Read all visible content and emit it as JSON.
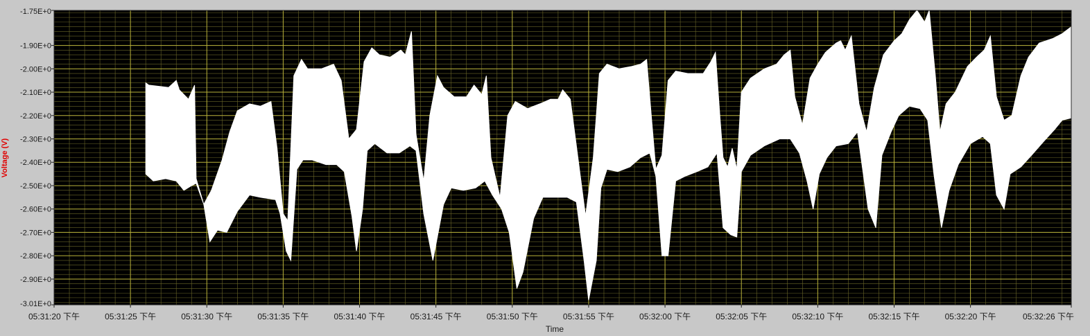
{
  "chart_data": {
    "type": "area",
    "xlabel": "Time",
    "ylabel": "Voltage (V)",
    "ylim": [
      -3.01,
      -1.75
    ],
    "xlim": [
      "05:31:20 下午",
      "05:32:26 下午"
    ],
    "grid": true,
    "colors": {
      "plot_bg": "#000000",
      "major_grid": "#b9b23a",
      "minor_grid": "#6a6628",
      "trace": "#ffffff",
      "ylabel_color": "#e00000",
      "frame_bg": "#c8c8c8"
    },
    "y_ticks": [
      {
        "value": -1.75,
        "label": "-1.75E+0"
      },
      {
        "value": -1.9,
        "label": "-1.90E+0"
      },
      {
        "value": -2.0,
        "label": "-2.00E+0"
      },
      {
        "value": -2.1,
        "label": "-2.10E+0"
      },
      {
        "value": -2.2,
        "label": "-2.20E+0"
      },
      {
        "value": -2.3,
        "label": "-2.30E+0"
      },
      {
        "value": -2.4,
        "label": "-2.40E+0"
      },
      {
        "value": -2.5,
        "label": "-2.50E+0"
      },
      {
        "value": -2.6,
        "label": "-2.60E+0"
      },
      {
        "value": -2.7,
        "label": "-2.70E+0"
      },
      {
        "value": -2.8,
        "label": "-2.80E+0"
      },
      {
        "value": -2.9,
        "label": "-2.90E+0"
      },
      {
        "value": -3.01,
        "label": "-3.01E+0"
      }
    ],
    "x_ticks": [
      {
        "t": 0,
        "label": "05:31:20 下午"
      },
      {
        "t": 5,
        "label": "05:31:25 下午"
      },
      {
        "t": 10,
        "label": "05:31:30 下午"
      },
      {
        "t": 15,
        "label": "05:31:35 下午"
      },
      {
        "t": 20,
        "label": "05:31:40 下午"
      },
      {
        "t": 25,
        "label": "05:31:45 下午"
      },
      {
        "t": 30,
        "label": "05:31:50 下午"
      },
      {
        "t": 35,
        "label": "05:31:55 下午"
      },
      {
        "t": 40,
        "label": "05:32:00 下午"
      },
      {
        "t": 45,
        "label": "05:32:05 下午"
      },
      {
        "t": 50,
        "label": "05:32:10 下午"
      },
      {
        "t": 55,
        "label": "05:32:15 下午"
      },
      {
        "t": 60,
        "label": "05:32:20 下午"
      },
      {
        "t": 66.6,
        "label": "05:32:26 下午"
      }
    ],
    "series": [
      {
        "x_unit": "seconds after 05:31:20 下午",
        "upper": [
          [
            6.0,
            -2.06
          ],
          [
            6.2,
            -2.07
          ],
          [
            7.5,
            -2.08
          ],
          [
            8.0,
            -2.05
          ],
          [
            8.2,
            -2.09
          ],
          [
            8.8,
            -2.13
          ],
          [
            9.2,
            -2.07
          ],
          [
            9.3,
            -2.47
          ],
          [
            9.8,
            -2.58
          ],
          [
            10.3,
            -2.52
          ],
          [
            11.0,
            -2.39
          ],
          [
            11.5,
            -2.27
          ],
          [
            12.0,
            -2.18
          ],
          [
            12.8,
            -2.15
          ],
          [
            13.5,
            -2.16
          ],
          [
            14.2,
            -2.14
          ],
          [
            14.6,
            -2.34
          ],
          [
            15.0,
            -2.62
          ],
          [
            15.3,
            -2.65
          ],
          [
            15.7,
            -2.03
          ],
          [
            16.2,
            -1.96
          ],
          [
            16.6,
            -2.0
          ],
          [
            17.5,
            -2.0
          ],
          [
            18.3,
            -1.98
          ],
          [
            18.8,
            -2.05
          ],
          [
            19.3,
            -2.3
          ],
          [
            19.8,
            -2.26
          ],
          [
            20.3,
            -1.97
          ],
          [
            20.8,
            -1.91
          ],
          [
            21.3,
            -1.94
          ],
          [
            22.0,
            -1.95
          ],
          [
            22.7,
            -1.92
          ],
          [
            23.0,
            -1.94
          ],
          [
            23.4,
            -1.84
          ],
          [
            23.7,
            -2.28
          ],
          [
            24.2,
            -2.48
          ],
          [
            24.6,
            -2.2
          ],
          [
            25.1,
            -2.03
          ],
          [
            25.5,
            -2.08
          ],
          [
            26.2,
            -2.12
          ],
          [
            27.0,
            -2.12
          ],
          [
            27.5,
            -2.07
          ],
          [
            28.0,
            -2.11
          ],
          [
            28.3,
            -2.03
          ],
          [
            28.6,
            -2.38
          ],
          [
            29.2,
            -2.55
          ],
          [
            29.7,
            -2.2
          ],
          [
            30.2,
            -2.14
          ],
          [
            31.0,
            -2.17
          ],
          [
            31.8,
            -2.15
          ],
          [
            32.5,
            -2.13
          ],
          [
            33.0,
            -2.13
          ],
          [
            33.3,
            -2.09
          ],
          [
            33.8,
            -2.13
          ],
          [
            34.4,
            -2.43
          ],
          [
            34.8,
            -2.63
          ],
          [
            35.3,
            -2.38
          ],
          [
            35.7,
            -2.02
          ],
          [
            36.2,
            -1.98
          ],
          [
            37.0,
            -2.0
          ],
          [
            37.8,
            -1.99
          ],
          [
            38.4,
            -1.98
          ],
          [
            38.8,
            -1.96
          ],
          [
            39.1,
            -2.2
          ],
          [
            39.4,
            -2.43
          ],
          [
            39.8,
            -2.37
          ],
          [
            40.2,
            -2.05
          ],
          [
            40.7,
            -2.01
          ],
          [
            41.5,
            -2.02
          ],
          [
            42.5,
            -2.02
          ],
          [
            43.0,
            -1.97
          ],
          [
            43.3,
            -1.93
          ],
          [
            43.6,
            -2.21
          ],
          [
            43.8,
            -2.38
          ],
          [
            44.1,
            -2.42
          ],
          [
            44.4,
            -2.34
          ],
          [
            44.7,
            -2.43
          ],
          [
            45.0,
            -2.1
          ],
          [
            45.6,
            -2.04
          ],
          [
            46.5,
            -2.0
          ],
          [
            47.3,
            -1.98
          ],
          [
            47.8,
            -1.94
          ],
          [
            48.2,
            -1.92
          ],
          [
            48.5,
            -2.12
          ],
          [
            49.0,
            -2.24
          ],
          [
            49.5,
            -2.04
          ],
          [
            50.0,
            -1.98
          ],
          [
            50.5,
            -1.93
          ],
          [
            51.2,
            -1.89
          ],
          [
            51.5,
            -1.88
          ],
          [
            51.8,
            -1.92
          ],
          [
            52.2,
            -1.86
          ],
          [
            52.7,
            -2.15
          ],
          [
            53.2,
            -2.27
          ],
          [
            53.7,
            -2.08
          ],
          [
            54.3,
            -1.94
          ],
          [
            55.0,
            -1.88
          ],
          [
            55.5,
            -1.85
          ],
          [
            56.0,
            -1.79
          ],
          [
            56.5,
            -1.75
          ],
          [
            57.0,
            -1.8
          ],
          [
            57.3,
            -1.75
          ],
          [
            57.7,
            -2.03
          ],
          [
            58.0,
            -2.27
          ],
          [
            58.4,
            -2.15
          ],
          [
            59.0,
            -2.1
          ],
          [
            59.8,
            -1.99
          ],
          [
            60.4,
            -1.95
          ],
          [
            60.9,
            -1.92
          ],
          [
            61.3,
            -1.86
          ],
          [
            61.7,
            -2.12
          ],
          [
            62.2,
            -2.22
          ],
          [
            62.7,
            -2.2
          ],
          [
            63.3,
            -2.03
          ],
          [
            63.8,
            -1.95
          ],
          [
            64.5,
            -1.89
          ],
          [
            65.4,
            -1.87
          ],
          [
            66.0,
            -1.85
          ],
          [
            66.6,
            -1.82
          ]
        ],
        "lower": [
          [
            6.0,
            -2.45
          ],
          [
            6.5,
            -2.48
          ],
          [
            7.3,
            -2.47
          ],
          [
            8.0,
            -2.48
          ],
          [
            8.5,
            -2.52
          ],
          [
            9.0,
            -2.5
          ],
          [
            9.3,
            -2.49
          ],
          [
            9.8,
            -2.58
          ],
          [
            10.2,
            -2.74
          ],
          [
            10.7,
            -2.69
          ],
          [
            11.3,
            -2.7
          ],
          [
            12.0,
            -2.61
          ],
          [
            12.8,
            -2.54
          ],
          [
            13.5,
            -2.55
          ],
          [
            14.5,
            -2.56
          ],
          [
            14.8,
            -2.62
          ],
          [
            15.2,
            -2.78
          ],
          [
            15.5,
            -2.82
          ],
          [
            15.9,
            -2.43
          ],
          [
            16.3,
            -2.39
          ],
          [
            16.9,
            -2.39
          ],
          [
            17.8,
            -2.41
          ],
          [
            18.5,
            -2.41
          ],
          [
            19.0,
            -2.44
          ],
          [
            19.5,
            -2.63
          ],
          [
            19.8,
            -2.78
          ],
          [
            20.2,
            -2.6
          ],
          [
            20.5,
            -2.35
          ],
          [
            21.0,
            -2.32
          ],
          [
            21.8,
            -2.36
          ],
          [
            22.6,
            -2.36
          ],
          [
            23.3,
            -2.33
          ],
          [
            23.7,
            -2.35
          ],
          [
            24.2,
            -2.62
          ],
          [
            24.8,
            -2.82
          ],
          [
            25.5,
            -2.58
          ],
          [
            26.0,
            -2.51
          ],
          [
            26.8,
            -2.52
          ],
          [
            27.6,
            -2.51
          ],
          [
            28.2,
            -2.48
          ],
          [
            28.7,
            -2.54
          ],
          [
            29.3,
            -2.6
          ],
          [
            29.8,
            -2.7
          ],
          [
            30.3,
            -2.94
          ],
          [
            30.7,
            -2.87
          ],
          [
            31.4,
            -2.64
          ],
          [
            32.0,
            -2.55
          ],
          [
            32.8,
            -2.55
          ],
          [
            33.6,
            -2.55
          ],
          [
            34.2,
            -2.57
          ],
          [
            34.7,
            -2.82
          ],
          [
            35.0,
            -2.99
          ],
          [
            35.5,
            -2.82
          ],
          [
            35.8,
            -2.51
          ],
          [
            36.2,
            -2.43
          ],
          [
            36.9,
            -2.44
          ],
          [
            37.7,
            -2.42
          ],
          [
            38.4,
            -2.38
          ],
          [
            39.0,
            -2.36
          ],
          [
            39.4,
            -2.46
          ],
          [
            39.8,
            -2.8
          ],
          [
            40.2,
            -2.8
          ],
          [
            40.7,
            -2.48
          ],
          [
            41.3,
            -2.46
          ],
          [
            42.1,
            -2.44
          ],
          [
            42.8,
            -2.42
          ],
          [
            43.4,
            -2.36
          ],
          [
            43.8,
            -2.68
          ],
          [
            44.3,
            -2.71
          ],
          [
            44.7,
            -2.72
          ],
          [
            45.0,
            -2.44
          ],
          [
            45.6,
            -2.37
          ],
          [
            46.5,
            -2.33
          ],
          [
            47.5,
            -2.3
          ],
          [
            48.2,
            -2.3
          ],
          [
            48.8,
            -2.36
          ],
          [
            49.3,
            -2.48
          ],
          [
            49.7,
            -2.6
          ],
          [
            50.1,
            -2.45
          ],
          [
            50.6,
            -2.38
          ],
          [
            51.2,
            -2.33
          ],
          [
            52.0,
            -2.32
          ],
          [
            52.6,
            -2.27
          ],
          [
            53.3,
            -2.6
          ],
          [
            53.8,
            -2.68
          ],
          [
            54.2,
            -2.37
          ],
          [
            54.8,
            -2.27
          ],
          [
            55.3,
            -2.2
          ],
          [
            56.0,
            -2.16
          ],
          [
            56.7,
            -2.17
          ],
          [
            57.2,
            -2.22
          ],
          [
            57.6,
            -2.45
          ],
          [
            58.1,
            -2.68
          ],
          [
            58.6,
            -2.52
          ],
          [
            59.2,
            -2.41
          ],
          [
            60.0,
            -2.32
          ],
          [
            60.8,
            -2.29
          ],
          [
            61.3,
            -2.32
          ],
          [
            61.7,
            -2.54
          ],
          [
            62.2,
            -2.6
          ],
          [
            62.6,
            -2.45
          ],
          [
            63.3,
            -2.42
          ],
          [
            64.0,
            -2.37
          ],
          [
            64.8,
            -2.31
          ],
          [
            65.5,
            -2.26
          ],
          [
            66.0,
            -2.22
          ],
          [
            66.6,
            -2.21
          ]
        ]
      }
    ]
  }
}
